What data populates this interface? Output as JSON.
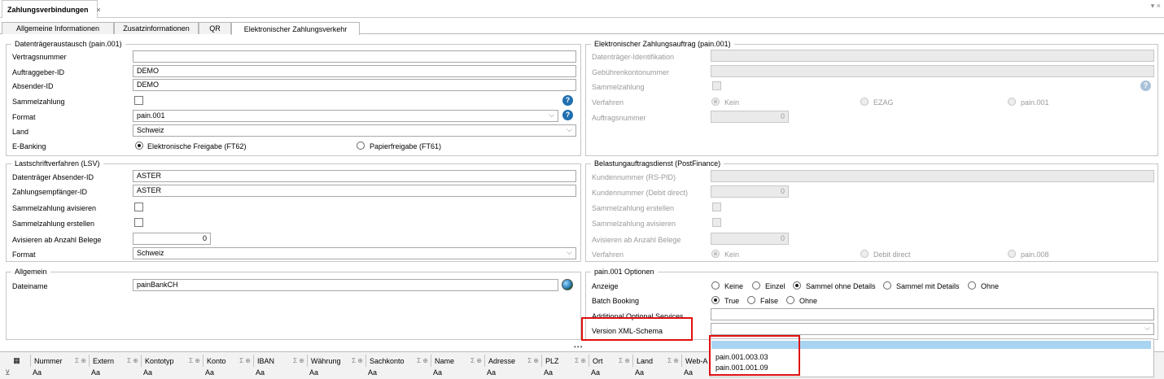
{
  "doc_tab": {
    "title": "Zahlungsverbindungen",
    "close": "×"
  },
  "window_controls": "▾ ×",
  "tabs": [
    "Allgemeine Informationen",
    "Zusatzinformationen",
    "QR",
    "Elektronischer Zahlungsverkehr"
  ],
  "dta": {
    "title": "Datenträgeraustausch (pain.001)",
    "vertragsnummer_label": "Vertragsnummer",
    "vertragsnummer_value": "",
    "auftraggeber_label": "Auftraggeber-ID",
    "auftraggeber_value": "DEMO",
    "absender_label": "Absender-ID",
    "absender_value": "DEMO",
    "sammel_label": "Sammelzahlung",
    "format_label": "Format",
    "format_value": "pain.001",
    "land_label": "Land",
    "land_value": "Schweiz",
    "ebanking_label": "E-Banking",
    "ebanking_opt1": "Elektronische Freigabe (FT62)",
    "ebanking_opt2": "Papierfreigabe (FT61)"
  },
  "ezv": {
    "title": "Elektronischer Zahlungsauftrag (pain.001)",
    "dt_id_label": "Datenträger-Identifikation",
    "gebuehren_label": "Gebührenkontonummer",
    "sammel_label": "Sammelzahlung",
    "verfahren_label": "Verfahren",
    "verf_opt1": "Kein",
    "verf_opt2": "EZAG",
    "verf_opt3": "pain.001",
    "auftragsnr_label": "Auftragsnummer",
    "auftragsnr_value": "0"
  },
  "lsv": {
    "title": "Lastschriftverfahren (LSV)",
    "dt_absender_label": "Datenträger Absender-ID",
    "dt_absender_value": "ASTER",
    "empf_label": "Zahlungsempfänger-ID",
    "empf_value": "ASTER",
    "avisieren_label": "Sammelzahlung avisieren",
    "erstellen_label": "Sammelzahlung erstellen",
    "ab_anzahl_label": "Avisieren ab Anzahl Belege",
    "ab_anzahl_value": "0",
    "format_label": "Format",
    "format_value": "Schweiz"
  },
  "bad": {
    "title": "Belastungauftragsdienst (PostFinance)",
    "kundennr_label": "Kundennummer (RS-PID)",
    "kundennr_dd_label": "Kundennummer (Debit direct)",
    "kundennr_dd_value": "0",
    "erstellen_label": "Sammelzahlung erstellen",
    "avisieren_label": "Sammelzahlung avisieren",
    "ab_anzahl_label": "Avisieren ab Anzahl Belege",
    "ab_anzahl_value": "0",
    "verfahren_label": "Verfahren",
    "verf_opt1": "Kein",
    "verf_opt2": "Debit direct",
    "verf_opt3": "pain.008"
  },
  "allgemein": {
    "title": "Allgemein",
    "dateiname_label": "Dateiname",
    "dateiname_value": "painBankCH"
  },
  "pain_opt": {
    "title": "pain.001 Optionen",
    "anzeige_label": "Anzeige",
    "anzeige_opts": [
      "Keine",
      "Einzel",
      "Sammel ohne Details",
      "Sammel mit Details",
      "Ohne"
    ],
    "batch_label": "Batch Booking",
    "batch_opts": [
      "True",
      "False",
      "Ohne"
    ],
    "add_services_label": "Additional Optional Services",
    "version_label": "Version XML-Schema",
    "version_value": "",
    "dropdown_options": [
      "",
      "pain.001.003.03",
      "pain.001.001.09"
    ]
  },
  "grid": {
    "columns": [
      "Nummer",
      "Extern",
      "Kontotyp",
      "Konto",
      "IBAN",
      "Währung",
      "Sachkonto",
      "Name",
      "Adresse",
      "PLZ",
      "Ort",
      "Land",
      "Web-A"
    ],
    "filter_placeholder": "Aa",
    "filter_icon": "filter-icon",
    "column_chooser_icon": "column-chooser-icon"
  },
  "splitter": "•••"
}
